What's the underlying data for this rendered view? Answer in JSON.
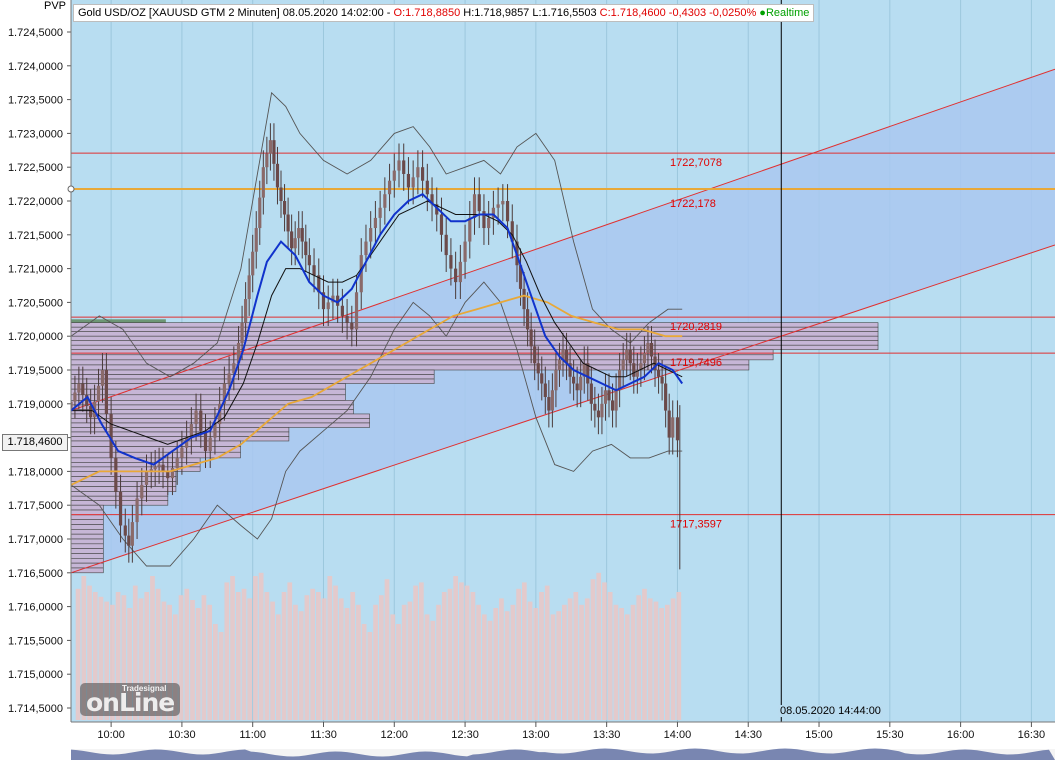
{
  "header": {
    "instrument": "Gold USD/OZ [XAUUSD GTM 2 Minuten]",
    "datetime": "08.05.2020 14:02:00",
    "ohlc": "O:1.718,8850",
    "high": "H:1.718,9857",
    "low": "L:1.716,5503",
    "close_change": "C:1.718,4600 -0,4303 -0,0250%",
    "realtime": "Realtime",
    "pvp": "PVP"
  },
  "current_price_box": "1.718,4600",
  "cursor_date": "08.05.2020 14:44:00",
  "logo": {
    "text": "onLine",
    "brand": "Tradesignal"
  },
  "colors": {
    "background": "#b8ddf1",
    "channel": "#a9c8f0",
    "red_line": "#e03030",
    "orange_line": "#e8a838",
    "blue_ma": "#1133cc",
    "black_ma": "#111111",
    "bollinger": "#555555",
    "volume": "#e8c8c8",
    "profile_green": "#5f8a5f",
    "profile_purple": "#c6b6d6"
  },
  "chart_data": {
    "type": "candlestick",
    "title": "Gold USD/OZ [XAUUSD GTM 2 Minuten]",
    "ylim": [
      1714.3,
      1725.0
    ],
    "y_ticks": [
      "1.724,5000",
      "1.724,0000",
      "1.723,5000",
      "1.723,0000",
      "1.722,5000",
      "1.722,0000",
      "1.721,5000",
      "1.721,0000",
      "1.720,5000",
      "1.720,0000",
      "1.719,5000",
      "1.719,0000",
      "1.718,5000",
      "1.718,0000",
      "1.717,5000",
      "1.717,0000",
      "1.716,5000",
      "1.716,0000",
      "1.715,5000",
      "1.715,0000",
      "1.714,5000"
    ],
    "y_tick_values": [
      1724.5,
      1724.0,
      1723.5,
      1723.0,
      1722.5,
      1722.0,
      1721.5,
      1721.0,
      1720.5,
      1720.0,
      1719.5,
      1719.0,
      1718.5,
      1718.0,
      1717.5,
      1717.0,
      1716.5,
      1716.0,
      1715.5,
      1715.0,
      1714.5
    ],
    "x_ticks": [
      "10:00",
      "10:30",
      "11:00",
      "11:30",
      "12:00",
      "12:30",
      "13:00",
      "13:30",
      "14:00",
      "14:30",
      "15:00",
      "15:30",
      "16:00",
      "16:30"
    ],
    "x_tick_minutes": [
      600,
      630,
      660,
      690,
      720,
      750,
      780,
      810,
      840,
      870,
      900,
      930,
      960,
      990
    ],
    "x_range_minutes": [
      583,
      1000
    ],
    "last_bar_minute": 842,
    "cursor_minute": 884,
    "horizontal_levels": [
      {
        "value": 1722.7078,
        "label": "1722,7078",
        "color": "red"
      },
      {
        "value": 1722.178,
        "label": "1722,178",
        "color": "orange"
      },
      {
        "value": 1720.2819,
        "label": "1720,2819",
        "color": "red"
      },
      {
        "value": 1719.7496,
        "label": "1719,7496",
        "color": "red"
      },
      {
        "value": 1717.3597,
        "label": "1717,3597",
        "color": "red"
      }
    ],
    "channel": {
      "upper": {
        "t0": 583,
        "v0": 1718.9,
        "t1": 1000,
        "v1": 1723.95
      },
      "lower": {
        "t0": 583,
        "v0": 1716.5,
        "t1": 1000,
        "v1": 1721.35
      }
    },
    "price_path": [
      [
        583,
        1718.9
      ],
      [
        588,
        1719.3
      ],
      [
        593,
        1718.8
      ],
      [
        598,
        1719.5
      ],
      [
        602,
        1718.2
      ],
      [
        606,
        1717.2
      ],
      [
        609,
        1716.9
      ],
      [
        613,
        1717.6
      ],
      [
        617,
        1718.0
      ],
      [
        622,
        1718.1
      ],
      [
        626,
        1717.9
      ],
      [
        630,
        1718.2
      ],
      [
        634,
        1718.5
      ],
      [
        638,
        1718.9
      ],
      [
        642,
        1718.3
      ],
      [
        646,
        1718.7
      ],
      [
        650,
        1719.3
      ],
      [
        654,
        1719.6
      ],
      [
        657,
        1720.2
      ],
      [
        660,
        1720.9
      ],
      [
        663,
        1721.6
      ],
      [
        666,
        1722.5
      ],
      [
        669,
        1722.9
      ],
      [
        672,
        1722.2
      ],
      [
        675,
        1721.8
      ],
      [
        678,
        1721.3
      ],
      [
        681,
        1721.6
      ],
      [
        684,
        1721.2
      ],
      [
        688,
        1720.9
      ],
      [
        692,
        1720.4
      ],
      [
        696,
        1720.6
      ],
      [
        700,
        1720.3
      ],
      [
        704,
        1720.1
      ],
      [
        708,
        1721.2
      ],
      [
        712,
        1721.6
      ],
      [
        716,
        1721.9
      ],
      [
        720,
        1722.3
      ],
      [
        724,
        1722.6
      ],
      [
        728,
        1722.2
      ],
      [
        732,
        1722.5
      ],
      [
        736,
        1722.1
      ],
      [
        740,
        1721.8
      ],
      [
        744,
        1721.2
      ],
      [
        748,
        1720.8
      ],
      [
        752,
        1721.4
      ],
      [
        756,
        1722.1
      ],
      [
        760,
        1721.6
      ],
      [
        764,
        1721.9
      ],
      [
        768,
        1722.0
      ],
      [
        772,
        1721.4
      ],
      [
        775,
        1720.7
      ],
      [
        778,
        1720.1
      ],
      [
        781,
        1719.6
      ],
      [
        784,
        1719.3
      ],
      [
        787,
        1718.9
      ],
      [
        790,
        1719.5
      ],
      [
        793,
        1719.8
      ],
      [
        796,
        1719.4
      ],
      [
        799,
        1719.2
      ],
      [
        802,
        1719.6
      ],
      [
        805,
        1719.0
      ],
      [
        808,
        1718.8
      ],
      [
        811,
        1719.2
      ],
      [
        814,
        1718.9
      ],
      [
        817,
        1719.5
      ],
      [
        820,
        1719.8
      ],
      [
        823,
        1719.4
      ],
      [
        826,
        1719.6
      ],
      [
        829,
        1719.9
      ],
      [
        832,
        1719.5
      ],
      [
        835,
        1719.3
      ],
      [
        838,
        1718.5
      ],
      [
        840,
        1718.8
      ],
      [
        842,
        1718.46
      ]
    ],
    "blue_ma": [
      [
        583,
        1718.9
      ],
      [
        590,
        1719.1
      ],
      [
        596,
        1718.7
      ],
      [
        603,
        1718.3
      ],
      [
        610,
        1718.2
      ],
      [
        618,
        1718.1
      ],
      [
        626,
        1718.3
      ],
      [
        634,
        1718.5
      ],
      [
        642,
        1718.6
      ],
      [
        650,
        1719.2
      ],
      [
        656,
        1719.8
      ],
      [
        662,
        1720.6
      ],
      [
        666,
        1721.1
      ],
      [
        672,
        1721.4
      ],
      [
        678,
        1721.2
      ],
      [
        684,
        1720.8
      ],
      [
        690,
        1720.6
      ],
      [
        696,
        1720.5
      ],
      [
        702,
        1720.7
      ],
      [
        708,
        1721.1
      ],
      [
        714,
        1721.5
      ],
      [
        720,
        1721.8
      ],
      [
        726,
        1722.0
      ],
      [
        732,
        1722.1
      ],
      [
        738,
        1721.9
      ],
      [
        744,
        1721.7
      ],
      [
        750,
        1721.7
      ],
      [
        756,
        1721.8
      ],
      [
        762,
        1721.8
      ],
      [
        768,
        1721.6
      ],
      [
        772,
        1721.2
      ],
      [
        778,
        1720.6
      ],
      [
        784,
        1720.0
      ],
      [
        790,
        1719.7
      ],
      [
        796,
        1719.5
      ],
      [
        802,
        1719.4
      ],
      [
        808,
        1719.3
      ],
      [
        814,
        1719.2
      ],
      [
        820,
        1719.3
      ],
      [
        826,
        1719.4
      ],
      [
        832,
        1719.6
      ],
      [
        838,
        1719.5
      ],
      [
        842,
        1719.3
      ]
    ],
    "black_ma": [
      [
        583,
        1718.9
      ],
      [
        592,
        1718.9
      ],
      [
        600,
        1718.7
      ],
      [
        608,
        1718.6
      ],
      [
        616,
        1718.5
      ],
      [
        624,
        1718.4
      ],
      [
        632,
        1718.5
      ],
      [
        640,
        1718.6
      ],
      [
        648,
        1718.8
      ],
      [
        656,
        1719.3
      ],
      [
        662,
        1719.9
      ],
      [
        668,
        1720.6
      ],
      [
        674,
        1721.0
      ],
      [
        680,
        1721.0
      ],
      [
        686,
        1720.9
      ],
      [
        692,
        1720.8
      ],
      [
        698,
        1720.8
      ],
      [
        704,
        1720.9
      ],
      [
        710,
        1721.2
      ],
      [
        716,
        1721.5
      ],
      [
        722,
        1721.8
      ],
      [
        728,
        1721.9
      ],
      [
        734,
        1722.0
      ],
      [
        740,
        1721.9
      ],
      [
        746,
        1721.8
      ],
      [
        752,
        1721.8
      ],
      [
        758,
        1721.8
      ],
      [
        764,
        1721.7
      ],
      [
        770,
        1721.5
      ],
      [
        776,
        1721.1
      ],
      [
        782,
        1720.6
      ],
      [
        788,
        1720.2
      ],
      [
        794,
        1719.9
      ],
      [
        800,
        1719.6
      ],
      [
        806,
        1719.5
      ],
      [
        812,
        1719.4
      ],
      [
        818,
        1719.4
      ],
      [
        824,
        1719.5
      ],
      [
        830,
        1719.6
      ],
      [
        836,
        1719.5
      ],
      [
        842,
        1719.4
      ]
    ],
    "orange_ma": [
      [
        583,
        1717.8
      ],
      [
        595,
        1718.0
      ],
      [
        605,
        1718.0
      ],
      [
        615,
        1718.0
      ],
      [
        625,
        1718.0
      ],
      [
        635,
        1718.1
      ],
      [
        645,
        1718.2
      ],
      [
        655,
        1718.4
      ],
      [
        665,
        1718.7
      ],
      [
        675,
        1719.0
      ],
      [
        685,
        1719.1
      ],
      [
        695,
        1719.3
      ],
      [
        705,
        1719.5
      ],
      [
        715,
        1719.7
      ],
      [
        725,
        1719.9
      ],
      [
        735,
        1720.1
      ],
      [
        745,
        1720.3
      ],
      [
        755,
        1720.4
      ],
      [
        765,
        1720.5
      ],
      [
        775,
        1720.6
      ],
      [
        785,
        1720.5
      ],
      [
        795,
        1720.3
      ],
      [
        805,
        1720.2
      ],
      [
        815,
        1720.1
      ],
      [
        825,
        1720.1
      ],
      [
        835,
        1720.0
      ],
      [
        842,
        1720.0
      ]
    ],
    "bollinger_upper": [
      [
        583,
        1720.0
      ],
      [
        595,
        1720.3
      ],
      [
        605,
        1720.1
      ],
      [
        615,
        1719.6
      ],
      [
        625,
        1719.4
      ],
      [
        635,
        1719.6
      ],
      [
        645,
        1719.9
      ],
      [
        655,
        1721.0
      ],
      [
        662,
        1722.4
      ],
      [
        668,
        1723.6
      ],
      [
        674,
        1723.4
      ],
      [
        680,
        1723.0
      ],
      [
        690,
        1722.6
      ],
      [
        700,
        1722.4
      ],
      [
        710,
        1722.6
      ],
      [
        720,
        1723.0
      ],
      [
        728,
        1723.1
      ],
      [
        735,
        1722.8
      ],
      [
        742,
        1722.4
      ],
      [
        750,
        1722.5
      ],
      [
        758,
        1722.6
      ],
      [
        765,
        1722.4
      ],
      [
        772,
        1722.8
      ],
      [
        780,
        1723.0
      ],
      [
        788,
        1722.6
      ],
      [
        796,
        1721.4
      ],
      [
        804,
        1720.4
      ],
      [
        812,
        1720.1
      ],
      [
        820,
        1719.9
      ],
      [
        828,
        1720.2
      ],
      [
        836,
        1720.4
      ],
      [
        842,
        1720.4
      ]
    ],
    "bollinger_lower": [
      [
        583,
        1717.8
      ],
      [
        595,
        1717.5
      ],
      [
        605,
        1717.0
      ],
      [
        615,
        1716.6
      ],
      [
        625,
        1716.6
      ],
      [
        635,
        1717.0
      ],
      [
        645,
        1717.5
      ],
      [
        655,
        1717.2
      ],
      [
        662,
        1717.0
      ],
      [
        668,
        1717.3
      ],
      [
        674,
        1718.0
      ],
      [
        680,
        1718.3
      ],
      [
        690,
        1718.6
      ],
      [
        700,
        1718.9
      ],
      [
        710,
        1719.4
      ],
      [
        720,
        1720.1
      ],
      [
        728,
        1720.5
      ],
      [
        735,
        1720.3
      ],
      [
        742,
        1720.0
      ],
      [
        750,
        1720.5
      ],
      [
        758,
        1720.8
      ],
      [
        765,
        1720.5
      ],
      [
        772,
        1719.8
      ],
      [
        780,
        1718.8
      ],
      [
        788,
        1718.1
      ],
      [
        796,
        1718.0
      ],
      [
        804,
        1718.3
      ],
      [
        812,
        1718.4
      ],
      [
        820,
        1718.2
      ],
      [
        828,
        1718.2
      ],
      [
        836,
        1718.3
      ],
      [
        842,
        1718.3
      ]
    ],
    "volume_profile": [
      {
        "low": 1720.25,
        "high": 1719.5,
        "len": 0.6,
        "green": true
      },
      {
        "low": 1719.5,
        "high": 1718.75,
        "len": 0.68,
        "green": true
      },
      {
        "low": 1718.75,
        "high": 1718.2,
        "len": 0.86,
        "green": true
      },
      {
        "low": 1718.2,
        "high": 1717.7,
        "len": 0.47,
        "green": true
      },
      {
        "low": 1717.5,
        "high": 1716.5,
        "len": 0.14,
        "green": false
      }
    ],
    "profile_bars": [
      [
        1720.2,
        1720.0,
        1.0
      ],
      [
        1720.0,
        1719.8,
        1.0
      ],
      [
        1719.8,
        1719.65,
        0.87
      ],
      [
        1719.65,
        1719.5,
        0.84
      ],
      [
        1719.5,
        1719.3,
        0.45
      ],
      [
        1719.3,
        1719.05,
        0.34
      ],
      [
        1719.05,
        1718.85,
        0.35
      ],
      [
        1718.85,
        1718.65,
        0.37
      ],
      [
        1718.65,
        1718.45,
        0.27
      ],
      [
        1718.45,
        1718.2,
        0.21
      ],
      [
        1718.2,
        1718.0,
        0.16
      ],
      [
        1718.0,
        1717.7,
        0.13
      ],
      [
        1717.7,
        1717.5,
        0.12
      ],
      [
        1717.5,
        1716.5,
        0.04
      ]
    ],
    "volume_bars": [
      0.82,
      0.9,
      0.84,
      0.8,
      0.77,
      0.74,
      0.72,
      0.8,
      0.78,
      0.7,
      0.84,
      0.76,
      0.8,
      0.9,
      0.82,
      0.74,
      0.72,
      0.66,
      0.78,
      0.82,
      0.75,
      0.7,
      0.78,
      0.72,
      0.6,
      0.55,
      0.86,
      0.9,
      0.8,
      0.82,
      0.76,
      0.9,
      0.92,
      0.8,
      0.74,
      0.66,
      0.8,
      0.86,
      0.72,
      0.68,
      0.78,
      0.82,
      0.8,
      0.76,
      0.9,
      0.84,
      0.76,
      0.7,
      0.8,
      0.72,
      0.6,
      0.55,
      0.72,
      0.78,
      0.88,
      0.66,
      0.6,
      0.72,
      0.74,
      0.84,
      0.86,
      0.66,
      0.62,
      0.72,
      0.8,
      0.82,
      0.9,
      0.86,
      0.84,
      0.8,
      0.72,
      0.66,
      0.62,
      0.7,
      0.76,
      0.68,
      0.72,
      0.82,
      0.86,
      0.74,
      0.7,
      0.8,
      0.84,
      0.66,
      0.68,
      0.72,
      0.76,
      0.8,
      0.72,
      0.76,
      0.88,
      0.92,
      0.86,
      0.8,
      0.72,
      0.7,
      0.66,
      0.72,
      0.78,
      0.82,
      0.76,
      0.74,
      0.7,
      0.72,
      0.76,
      0.8
    ]
  }
}
